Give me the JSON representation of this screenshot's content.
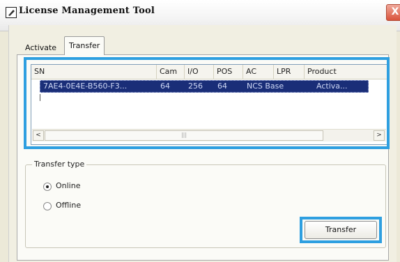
{
  "window": {
    "title": "License Management Tool",
    "close_glyph": "X"
  },
  "tabs": [
    {
      "label": "Activate",
      "selected": false
    },
    {
      "label": "Transfer",
      "selected": true
    }
  ],
  "license_list": {
    "columns": [
      "SN",
      "Cam",
      "I/O",
      "POS",
      "AC",
      "LPR",
      "Product"
    ],
    "rows": [
      {
        "sn": "7AE4-0E4E-B560-F3...",
        "cam": "64",
        "io": "256",
        "pos": "64",
        "ac": "NCS Base",
        "lpr": "",
        "product": "Activa..."
      }
    ],
    "scroll_left_glyph": "<",
    "scroll_right_glyph": ">",
    "scroll_thumb_grip": "|||"
  },
  "transfer_type": {
    "label": "Transfer type",
    "options": [
      {
        "label": "Online",
        "checked": true
      },
      {
        "label": "Offline",
        "checked": false
      }
    ]
  },
  "actions": {
    "transfer_button": "Transfer"
  },
  "colors": {
    "highlight": "#2e9fe0",
    "selected_row": "#1a2e78"
  }
}
